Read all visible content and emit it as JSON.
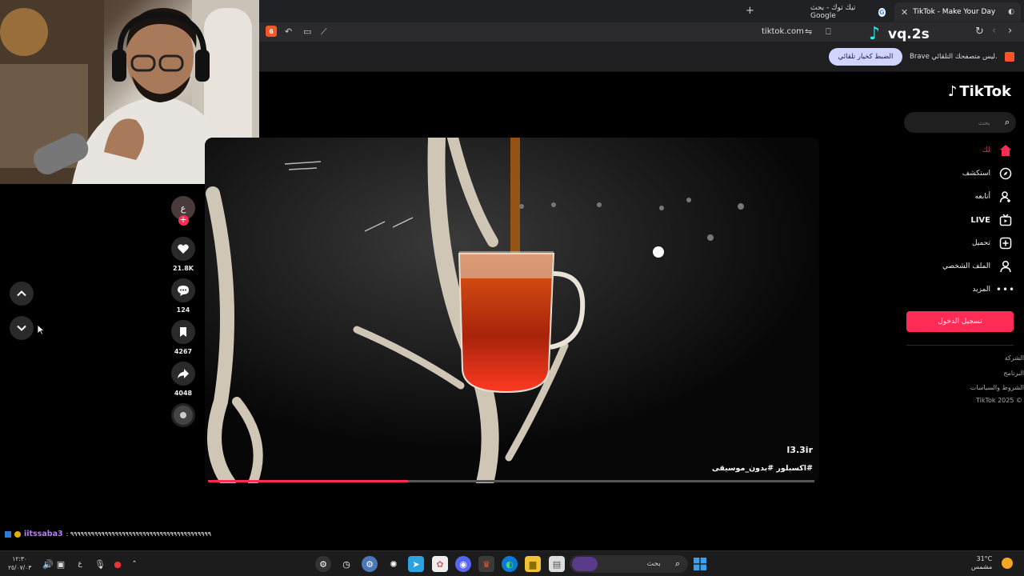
{
  "browser": {
    "tabs": [
      {
        "title": "TikTok - Make Your Day",
        "active": true
      },
      {
        "title": "تيك توك - بحث Google",
        "active": false
      }
    ],
    "new_tab_label": "+",
    "url": "tiktok.com",
    "infobar_text": "Brave ليس متصفحك التلقائي.",
    "infobar_button": "الضبط كخيار تلقائي",
    "shields_count": "6"
  },
  "overlay": {
    "watermark": "vq.2s",
    "chat_user": "iitssaba3",
    "chat_message": ": ٩٩٩٩٩٩٩٩٩٩٩٩٩٩٩٩٩٩٩٩٩٩٩٩٩٩٩٩٩٩٩٩٩٩٩٩٩٩٩٩٩"
  },
  "tiktok": {
    "logo": "TikTok",
    "search_placeholder": "بحث",
    "nav": [
      {
        "label": "لك",
        "icon": "home-icon",
        "active": true
      },
      {
        "label": "استكشف",
        "icon": "compass-icon"
      },
      {
        "label": "أتابعه",
        "icon": "following-icon"
      },
      {
        "label": "LIVE",
        "icon": "live-icon"
      },
      {
        "label": "تحميل",
        "icon": "upload-icon"
      },
      {
        "label": "الملف الشخصي",
        "icon": "profile-icon"
      },
      {
        "label": "المزيد",
        "icon": "more-icon"
      }
    ],
    "login_button": "تسجيل الدخول",
    "footer": [
      "الشركة",
      "البرنامج",
      "الشروط والسياسات",
      "TikTok 2025 ©"
    ],
    "accent": "#fe2c55"
  },
  "video": {
    "author": "l3.3ir",
    "caption": "#اكسبلور #بدون_موسيقى",
    "progress": 0.33,
    "avatar_letter": "ع",
    "likes": "21.8K",
    "comments": "124",
    "saves": "4267",
    "shares": "4048"
  },
  "taskbar": {
    "search_label": "بحث",
    "weather_temp": "31°C",
    "weather_text": "مشمس",
    "time": "١٢:٣٠",
    "date": "٢٥/٠٧/٠٣",
    "lang": "ع"
  }
}
